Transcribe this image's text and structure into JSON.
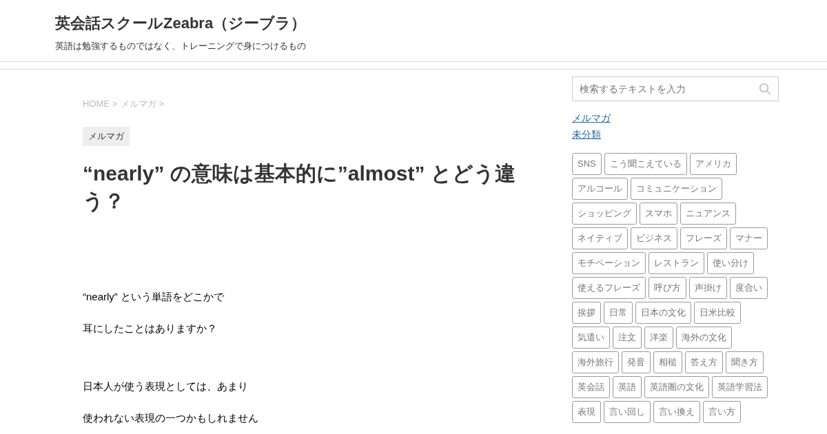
{
  "site": {
    "title": "英会話スクールZeabra（ジーブラ）",
    "tagline": "英語は勉強するものではなく、トレーニングで身につけるもの"
  },
  "breadcrumb": [
    {
      "label": "HOME",
      "separator": ">"
    },
    {
      "label": "メルマガ",
      "separator": ">"
    }
  ],
  "category_label": "メルマガ",
  "article": {
    "title": "“nearly” の意味は基本的に”almost” とどう違う？",
    "paragraph_groups": [
      [
        "“nearly” という単語をどこかで",
        "耳にしたことはありますか？"
      ],
      [
        "日本人が使う表現としては、あまり",
        "使われない表現の一つかもしれません"
      ]
    ]
  },
  "sidebar": {
    "search": {
      "placeholder": "検索するテキストを入力"
    },
    "categories": [
      "メルマガ",
      "未分類"
    ],
    "tags": [
      "SNS",
      "こう聞こえている",
      "アメリカ",
      "アルコール",
      "コミュニケーション",
      "ショッピング",
      "スマホ",
      "ニュアンス",
      "ネイティブ",
      "ビジネス",
      "フレーズ",
      "マナー",
      "モチベーション",
      "レストラン",
      "使い分け",
      "使えるフレーズ",
      "呼び方",
      "声掛け",
      "度合い",
      "挨拶",
      "日常",
      "日本の文化",
      "日米比較",
      "気遣い",
      "注文",
      "洋楽",
      "海外の文化",
      "海外旅行",
      "発音",
      "相槌",
      "答え方",
      "聞き方",
      "英会話",
      "英語",
      "英語圏の文化",
      "英語学習法",
      "表現",
      "言い回し",
      "言い換え",
      "言い方"
    ]
  }
}
